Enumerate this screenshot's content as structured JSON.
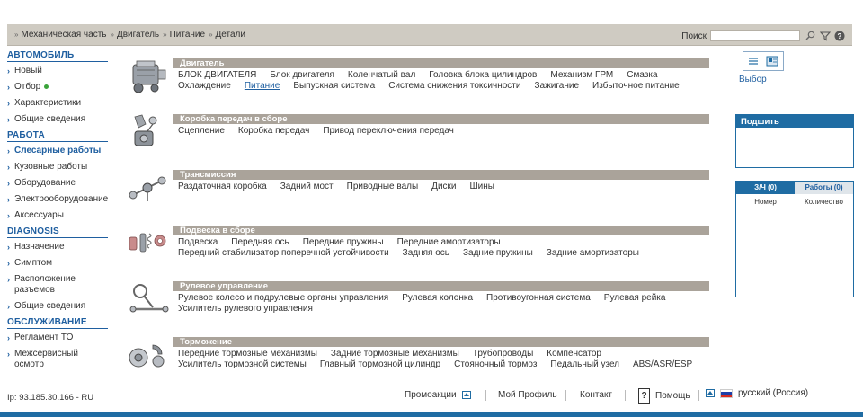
{
  "breadcrumb": {
    "items": [
      "Механическая часть",
      "Двигатель",
      "Питание",
      "Детали"
    ]
  },
  "search": {
    "label": "Поиск",
    "value": "",
    "placeholder": ""
  },
  "sidebar": {
    "sections": [
      {
        "title": "АВТОМОБИЛЬ",
        "items": [
          {
            "label": "Новый"
          },
          {
            "label": "Отбор",
            "status_dot": true
          },
          {
            "label": "Характеристики"
          },
          {
            "label": "Общие сведения"
          }
        ]
      },
      {
        "title": "РАБОТА",
        "items": [
          {
            "label": "Слесарные работы",
            "active": true
          },
          {
            "label": "Кузовные работы"
          },
          {
            "label": "Оборудование"
          },
          {
            "label": "Электрооборудование"
          },
          {
            "label": "Аксессуары"
          }
        ]
      },
      {
        "title": "DIAGNOSIS",
        "items": [
          {
            "label": "Назначение"
          },
          {
            "label": "Симптом"
          },
          {
            "label": "Расположение разъемов"
          },
          {
            "label": "Общие сведения"
          }
        ]
      },
      {
        "title": "ОБСЛУЖИВАНИЕ",
        "items": [
          {
            "label": "Регламент ТО"
          },
          {
            "label": "Межсервисный осмотр"
          }
        ]
      }
    ]
  },
  "categories": [
    {
      "title": "Двигатель",
      "icon": "engine-icon",
      "links": [
        "БЛОК ДВИГАТЕЛЯ",
        "Блок двигателя",
        "Коленчатый вал",
        "Головка блока цилиндров",
        "Механизм ГРМ",
        "Смазка",
        "Охлаждение",
        "Питание",
        "Выпускная система",
        "Система снижения токсичности",
        "Зажигание",
        "Избыточное питание"
      ],
      "active_link": "Питание"
    },
    {
      "title": "Коробка передач в сборе",
      "icon": "gearbox-icon",
      "links": [
        "Сцепление",
        "Коробка передач",
        "Привод переключения передач"
      ]
    },
    {
      "title": "Трансмиссия",
      "icon": "axle-icon",
      "links": [
        "Раздаточная коробка",
        "Задний мост",
        "Приводные валы",
        "Диски",
        "Шины"
      ]
    },
    {
      "title": "Подвеска в сборе",
      "icon": "suspension-icon",
      "links": [
        "Подвеска",
        "Передняя ось",
        "Передние пружины",
        "Передние амортизаторы",
        "Передний стабилизатор поперечной устойчивости",
        "Задняя ось",
        "Задние пружины",
        "Задние амортизаторы"
      ]
    },
    {
      "title": "Рулевое управление",
      "icon": "steering-icon",
      "links": [
        "Рулевое колесо и подрулевые органы управления",
        "Рулевая колонка",
        "Противоугонная система",
        "Рулевая рейка",
        "Усилитель рулевого управления"
      ]
    },
    {
      "title": "Торможение",
      "icon": "brake-icon",
      "links": [
        "Передние тормозные механизмы",
        "Задние тормозные механизмы",
        "Трубопроводы",
        "Компенсатор",
        "Усилитель тормозной системы",
        "Главный тормозной цилиндр",
        "Стояночный тормоз",
        "Педальный узел",
        "ABS/ASR/ESP"
      ]
    }
  ],
  "right": {
    "select_label": "Выбор",
    "pin_panel_title": "Подшить",
    "tabs": [
      "З/Ч (0)",
      "Работы (0)"
    ],
    "columns": [
      "Номер",
      "Количество"
    ]
  },
  "footer": {
    "ip": "Ip: 93.185.30.166 - RU",
    "promotions": "Промоакции",
    "profile": "Мой Профиль",
    "contact": "Контакт",
    "help": "Помощь",
    "language": "русский (Россия)"
  },
  "colors": {
    "accent": "#1f6ca3",
    "bar_gray": "#aaa39a",
    "top_bar": "#cfcbc2"
  }
}
